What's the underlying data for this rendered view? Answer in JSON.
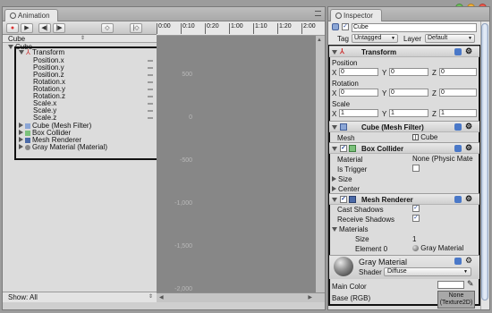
{
  "animation": {
    "tab_label": "Animation",
    "object_selector": "Cube",
    "tree_root": "Cube",
    "transform_label": "Transform",
    "props": [
      "Position.x",
      "Position.y",
      "Position.z",
      "Rotation.x",
      "Rotation.y",
      "Rotation.z",
      "Scale.x",
      "Scale.y",
      "Scale.z"
    ],
    "components": [
      "Cube (Mesh Filter)",
      "Box Collider",
      "Mesh Renderer",
      "Gray Material (Material)"
    ],
    "timeline_marks": [
      "0:00",
      "0:10",
      "0:20",
      "1:00",
      "1:10",
      "1:20",
      "2:00"
    ],
    "curve_labels": [
      "500",
      "0",
      "-500",
      "-1,000",
      "-1,500",
      "-2,000"
    ],
    "show_label": "Show: All"
  },
  "inspector": {
    "tab_label": "Inspector",
    "object_name": "Cube",
    "tag_label": "Tag",
    "tag_value": "Untagged",
    "layer_label": "Layer",
    "layer_value": "Default",
    "transform": {
      "title": "Transform",
      "position_label": "Position",
      "rotation_label": "Rotation",
      "scale_label": "Scale",
      "position": {
        "x": "0",
        "y": "0",
        "z": "0"
      },
      "rotation": {
        "x": "0",
        "y": "0",
        "z": "0"
      },
      "scale": {
        "x": "1",
        "y": "1",
        "z": "1"
      }
    },
    "mesh_filter": {
      "title": "Cube (Mesh Filter)",
      "mesh_label": "Mesh",
      "mesh_value": "Cube"
    },
    "box_collider": {
      "title": "Box Collider",
      "material_label": "Material",
      "material_value": "None (Physic Mate",
      "trigger_label": "Is Trigger",
      "size_label": "Size",
      "center_label": "Center"
    },
    "mesh_renderer": {
      "title": "Mesh Renderer",
      "cast_label": "Cast Shadows",
      "receive_label": "Receive Shadows",
      "materials_label": "Materials",
      "size_label": "Size",
      "size_value": "1",
      "element_label": "Element 0",
      "element_value": "Gray Material"
    },
    "material": {
      "title": "Gray Material",
      "shader_label": "Shader",
      "shader_value": "Diffuse",
      "main_color_label": "Main Color",
      "base_label": "Base (RGB)",
      "texture_line1": "None",
      "texture_line2": "(Texture2D)"
    },
    "axes": {
      "x": "X",
      "y": "Y",
      "z": "Z"
    }
  }
}
